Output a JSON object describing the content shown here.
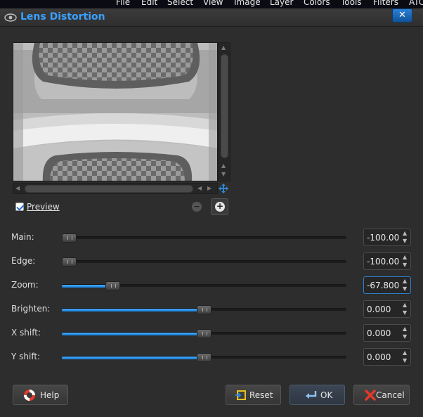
{
  "menubar": {
    "items": [
      "File",
      "Edit",
      "Select",
      "View",
      "Image",
      "Layer",
      "Colors",
      "Tools",
      "Filters",
      "ATC"
    ]
  },
  "dialog": {
    "title": "Lens Distortion",
    "close_symbol": "✕"
  },
  "preview": {
    "label": "Preview",
    "checked": true,
    "zoom_out_symbol": "−",
    "zoom_in_symbol": "+"
  },
  "parameters": [
    {
      "label": "Main:",
      "value": "-100.00",
      "fraction": 0.0
    },
    {
      "label": "Edge:",
      "value": "-100.00",
      "fraction": 0.0
    },
    {
      "label": "Zoom:",
      "value": "-67.800",
      "fraction": 0.161
    },
    {
      "label": "Brighten:",
      "value": "0.000",
      "fraction": 0.5
    },
    {
      "label": "X shift:",
      "value": "0.000",
      "fraction": 0.5
    },
    {
      "label": "Y shift:",
      "value": "0.000",
      "fraction": 0.5
    }
  ],
  "buttons": {
    "help": "Help",
    "reset": "Reset",
    "ok": "OK",
    "cancel": "Cancel"
  },
  "colors": {
    "title": "#3aa0ff",
    "slider_fill": "#1e8ae6",
    "dialog_bg": "#2d2d2d"
  }
}
